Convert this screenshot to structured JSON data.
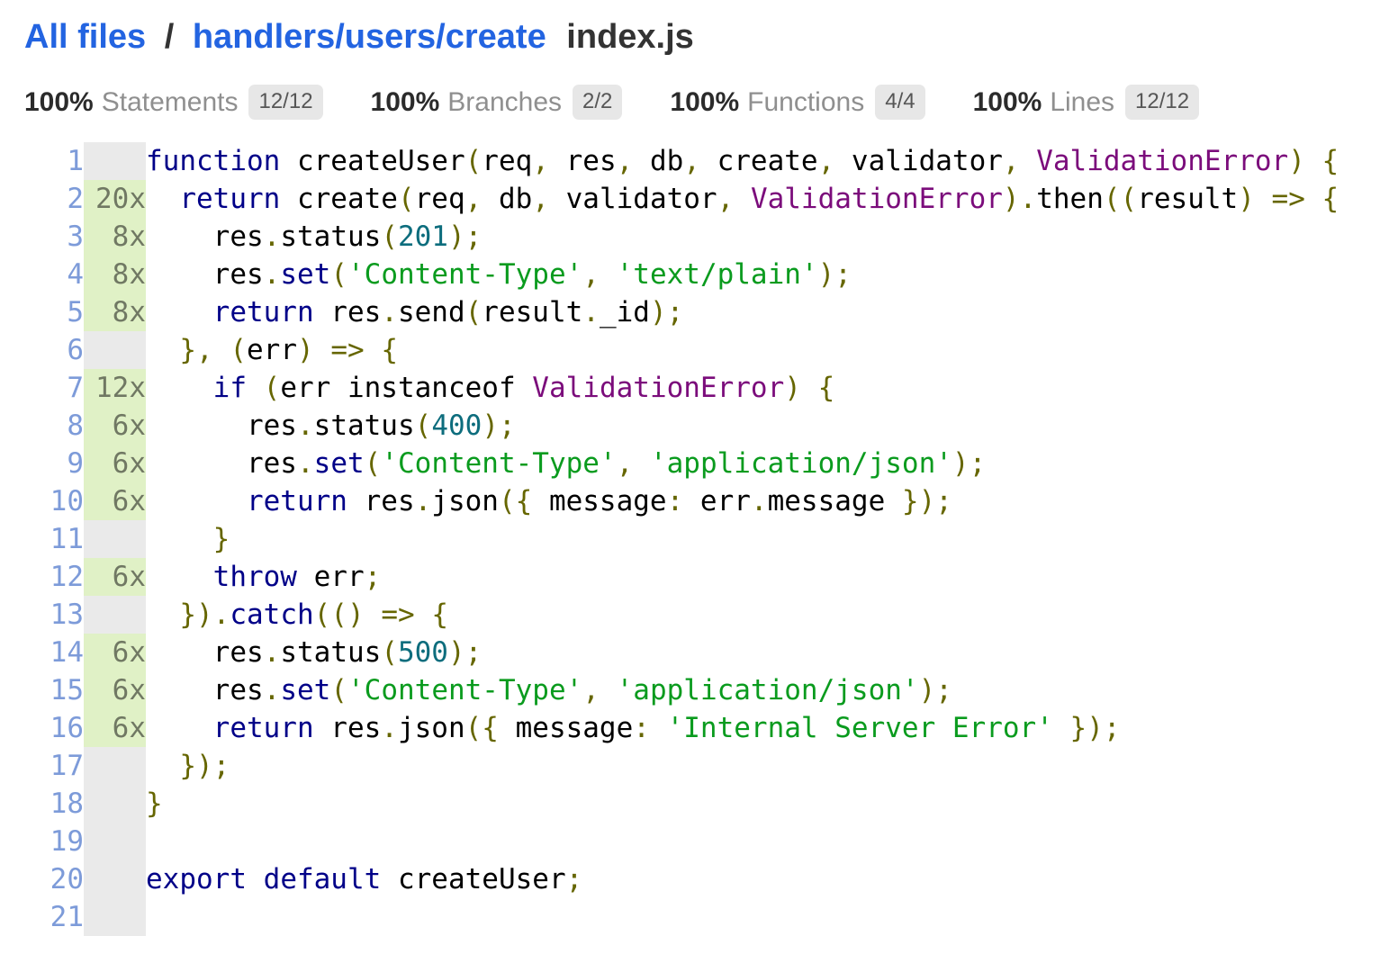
{
  "header": {
    "breadcrumb_root": "All files",
    "separator": "/",
    "breadcrumb_dir": "handlers/users/create",
    "file_name": "index.js"
  },
  "stats": [
    {
      "pct": "100%",
      "label": "Statements",
      "fraction": "12/12"
    },
    {
      "pct": "100%",
      "label": "Branches",
      "fraction": "2/2"
    },
    {
      "pct": "100%",
      "label": "Functions",
      "fraction": "4/4"
    },
    {
      "pct": "100%",
      "label": "Lines",
      "fraction": "12/12"
    }
  ],
  "colors": {
    "link_blue": "#2364E1",
    "line_number_blue": "#7D9BD9",
    "covered_bg": "#E0F1C6",
    "neutral_bg": "#EAEAEA",
    "keyword": "#000088",
    "string": "#0A9B1E",
    "type": "#7B0C7B",
    "literal": "#0D6D7D",
    "punctuation": "#666600"
  },
  "code": {
    "lines": [
      {
        "no": "1",
        "count": "",
        "cov": "neutral",
        "tokens": [
          [
            "k",
            "function"
          ],
          [
            "n",
            " createUser"
          ],
          [
            "p",
            "("
          ],
          [
            "n",
            "req"
          ],
          [
            "p",
            ", "
          ],
          [
            "n",
            "res"
          ],
          [
            "p",
            ", "
          ],
          [
            "n",
            "db"
          ],
          [
            "p",
            ", "
          ],
          [
            "n",
            "create"
          ],
          [
            "p",
            ", "
          ],
          [
            "n",
            "validator"
          ],
          [
            "p",
            ", "
          ],
          [
            "t",
            "ValidationError"
          ],
          [
            "p",
            ") {"
          ]
        ]
      },
      {
        "no": "2",
        "count": "20x",
        "cov": "yes",
        "tokens": [
          [
            "n",
            "  "
          ],
          [
            "k",
            "return"
          ],
          [
            "n",
            " create"
          ],
          [
            "p",
            "("
          ],
          [
            "n",
            "req"
          ],
          [
            "p",
            ", "
          ],
          [
            "n",
            "db"
          ],
          [
            "p",
            ", "
          ],
          [
            "n",
            "validator"
          ],
          [
            "p",
            ", "
          ],
          [
            "t",
            "ValidationError"
          ],
          [
            "p",
            ")."
          ],
          [
            "n",
            "then"
          ],
          [
            "p",
            "(("
          ],
          [
            "n",
            "result"
          ],
          [
            "p",
            ") => {"
          ]
        ]
      },
      {
        "no": "3",
        "count": "8x",
        "cov": "yes",
        "tokens": [
          [
            "n",
            "    res"
          ],
          [
            "p",
            "."
          ],
          [
            "n",
            "status"
          ],
          [
            "p",
            "("
          ],
          [
            "l",
            "201"
          ],
          [
            "p",
            ");"
          ]
        ]
      },
      {
        "no": "4",
        "count": "8x",
        "cov": "yes",
        "tokens": [
          [
            "n",
            "    res"
          ],
          [
            "p",
            "."
          ],
          [
            "k",
            "set"
          ],
          [
            "p",
            "("
          ],
          [
            "s",
            "'Content-Type'"
          ],
          [
            "p",
            ", "
          ],
          [
            "s",
            "'text/plain'"
          ],
          [
            "p",
            ");"
          ]
        ]
      },
      {
        "no": "5",
        "count": "8x",
        "cov": "yes",
        "tokens": [
          [
            "n",
            "    "
          ],
          [
            "k",
            "return"
          ],
          [
            "n",
            " res"
          ],
          [
            "p",
            "."
          ],
          [
            "n",
            "send"
          ],
          [
            "p",
            "("
          ],
          [
            "n",
            "result"
          ],
          [
            "p",
            "."
          ],
          [
            "n",
            "_id"
          ],
          [
            "p",
            ");"
          ]
        ]
      },
      {
        "no": "6",
        "count": "",
        "cov": "neutral",
        "tokens": [
          [
            "n",
            "  "
          ],
          [
            "p",
            "},"
          ],
          [
            "n",
            " "
          ],
          [
            "p",
            "("
          ],
          [
            "n",
            "err"
          ],
          [
            "p",
            ") => {"
          ]
        ]
      },
      {
        "no": "7",
        "count": "12x",
        "cov": "yes",
        "tokens": [
          [
            "n",
            "    "
          ],
          [
            "k",
            "if"
          ],
          [
            "n",
            " "
          ],
          [
            "p",
            "("
          ],
          [
            "n",
            "err instanceof "
          ],
          [
            "t",
            "ValidationError"
          ],
          [
            "p",
            ") {"
          ]
        ]
      },
      {
        "no": "8",
        "count": "6x",
        "cov": "yes",
        "tokens": [
          [
            "n",
            "      res"
          ],
          [
            "p",
            "."
          ],
          [
            "n",
            "status"
          ],
          [
            "p",
            "("
          ],
          [
            "l",
            "400"
          ],
          [
            "p",
            ");"
          ]
        ]
      },
      {
        "no": "9",
        "count": "6x",
        "cov": "yes",
        "tokens": [
          [
            "n",
            "      res"
          ],
          [
            "p",
            "."
          ],
          [
            "k",
            "set"
          ],
          [
            "p",
            "("
          ],
          [
            "s",
            "'Content-Type'"
          ],
          [
            "p",
            ", "
          ],
          [
            "s",
            "'application/json'"
          ],
          [
            "p",
            ");"
          ]
        ]
      },
      {
        "no": "10",
        "count": "6x",
        "cov": "yes",
        "tokens": [
          [
            "n",
            "      "
          ],
          [
            "k",
            "return"
          ],
          [
            "n",
            " res"
          ],
          [
            "p",
            "."
          ],
          [
            "n",
            "json"
          ],
          [
            "p",
            "({"
          ],
          [
            "n",
            " message"
          ],
          [
            "p",
            ":"
          ],
          [
            "n",
            " err"
          ],
          [
            "p",
            "."
          ],
          [
            "n",
            "message"
          ],
          [
            "p",
            " });"
          ]
        ]
      },
      {
        "no": "11",
        "count": "",
        "cov": "neutral",
        "tokens": [
          [
            "n",
            "    "
          ],
          [
            "p",
            "}"
          ]
        ]
      },
      {
        "no": "12",
        "count": "6x",
        "cov": "yes",
        "tokens": [
          [
            "n",
            "    "
          ],
          [
            "k",
            "throw"
          ],
          [
            "n",
            " err"
          ],
          [
            "p",
            ";"
          ]
        ]
      },
      {
        "no": "13",
        "count": "",
        "cov": "neutral",
        "tokens": [
          [
            "n",
            "  "
          ],
          [
            "p",
            "})."
          ],
          [
            "k",
            "catch"
          ],
          [
            "p",
            "(()"
          ],
          [
            "n",
            " "
          ],
          [
            "p",
            "=> {"
          ]
        ]
      },
      {
        "no": "14",
        "count": "6x",
        "cov": "yes",
        "tokens": [
          [
            "n",
            "    res"
          ],
          [
            "p",
            "."
          ],
          [
            "n",
            "status"
          ],
          [
            "p",
            "("
          ],
          [
            "l",
            "500"
          ],
          [
            "p",
            ");"
          ]
        ]
      },
      {
        "no": "15",
        "count": "6x",
        "cov": "yes",
        "tokens": [
          [
            "n",
            "    res"
          ],
          [
            "p",
            "."
          ],
          [
            "k",
            "set"
          ],
          [
            "p",
            "("
          ],
          [
            "s",
            "'Content-Type'"
          ],
          [
            "p",
            ", "
          ],
          [
            "s",
            "'application/json'"
          ],
          [
            "p",
            ");"
          ]
        ]
      },
      {
        "no": "16",
        "count": "6x",
        "cov": "yes",
        "tokens": [
          [
            "n",
            "    "
          ],
          [
            "k",
            "return"
          ],
          [
            "n",
            " res"
          ],
          [
            "p",
            "."
          ],
          [
            "n",
            "json"
          ],
          [
            "p",
            "({"
          ],
          [
            "n",
            " message"
          ],
          [
            "p",
            ":"
          ],
          [
            "n",
            " "
          ],
          [
            "s",
            "'Internal Server Error'"
          ],
          [
            "p",
            " });"
          ]
        ]
      },
      {
        "no": "17",
        "count": "",
        "cov": "neutral",
        "tokens": [
          [
            "n",
            "  "
          ],
          [
            "p",
            "});"
          ]
        ]
      },
      {
        "no": "18",
        "count": "",
        "cov": "neutral",
        "tokens": [
          [
            "p",
            "}"
          ]
        ]
      },
      {
        "no": "19",
        "count": "",
        "cov": "neutral",
        "tokens": []
      },
      {
        "no": "20",
        "count": "",
        "cov": "neutral",
        "tokens": [
          [
            "k",
            "export"
          ],
          [
            "n",
            " "
          ],
          [
            "k",
            "default"
          ],
          [
            "n",
            " createUser"
          ],
          [
            "p",
            ";"
          ]
        ]
      },
      {
        "no": "21",
        "count": "",
        "cov": "neutral",
        "tokens": []
      }
    ]
  }
}
